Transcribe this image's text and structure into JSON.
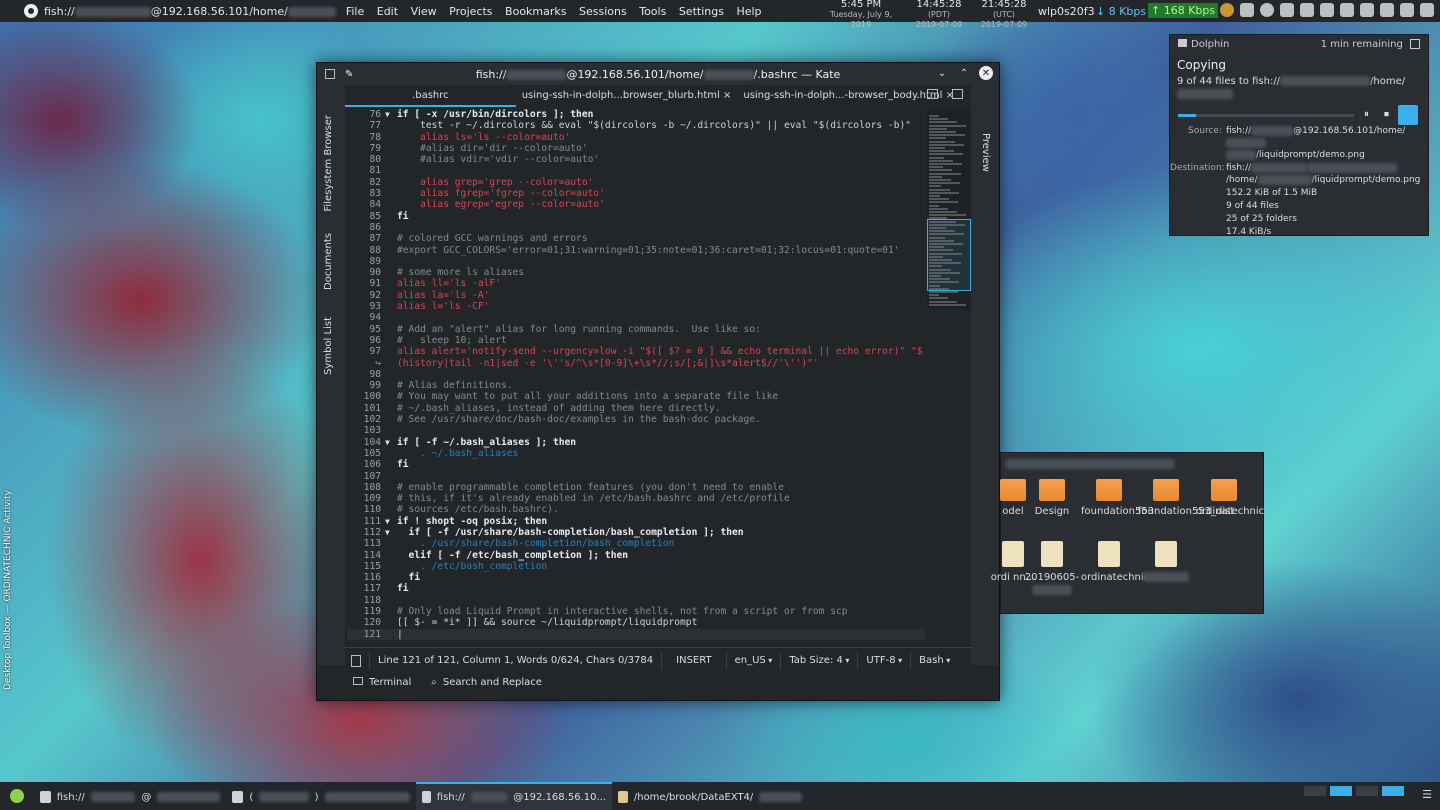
{
  "topbar": {
    "app": "fish://",
    "app_suffix": "@192.168.56.101/home/",
    "menu": [
      "File",
      "Edit",
      "View",
      "Projects",
      "Bookmarks",
      "Sessions",
      "Tools",
      "Settings",
      "Help"
    ],
    "clock1_time": "5:45 PM",
    "clock1_date": "Tuesday, July 9, 2019",
    "clock2_time": "14:45:28",
    "clock2_tz": "(PDT)",
    "clock2_date": "2019-07-09",
    "clock3_time": "21:45:28",
    "clock3_tz": "(UTC)",
    "clock3_date": "2019-07-09",
    "iface": "wlp0s20f3",
    "down": "8 Kbps",
    "up": "168 Kbps"
  },
  "kate": {
    "title_prefix": "fish://",
    "title_mid": "@192.168.56.101/home/",
    "title_suffix": "/.bashrc — Kate",
    "tabs": [
      ".bashrc",
      "using-ssh-in-dolph...browser_blurb.html",
      "using-ssh-in-dolph...-browser_body.html"
    ],
    "left_panels": [
      "Filesystem Browser",
      "Documents",
      "Symbol List"
    ],
    "right_panels": [
      "Preview"
    ],
    "lines": [
      {
        "n": "76",
        "f": "▼",
        "t": "if [ -x /usr/bin/dircolors ]; then"
      },
      {
        "n": "77",
        "f": "",
        "t": "    test -r ~/.dircolors && eval \"$(dircolors -b ~/.dircolors)\" || eval \"$(dircolors -b)\""
      },
      {
        "n": "78",
        "f": "",
        "t": "    alias ls='ls --color=auto'"
      },
      {
        "n": "79",
        "f": "",
        "t": "    #alias dir='dir --color=auto'"
      },
      {
        "n": "80",
        "f": "",
        "t": "    #alias vdir='vdir --color=auto'"
      },
      {
        "n": "81",
        "f": "",
        "t": ""
      },
      {
        "n": "82",
        "f": "",
        "t": "    alias grep='grep --color=auto'"
      },
      {
        "n": "83",
        "f": "",
        "t": "    alias fgrep='fgrep --color=auto'"
      },
      {
        "n": "84",
        "f": "",
        "t": "    alias egrep='egrep --color=auto'"
      },
      {
        "n": "85",
        "f": "",
        "t": "fi"
      },
      {
        "n": "86",
        "f": "",
        "t": ""
      },
      {
        "n": "87",
        "f": "",
        "t": "# colored GCC warnings and errors"
      },
      {
        "n": "88",
        "f": "",
        "t": "#export GCC_COLORS='error=01;31:warning=01;35:note=01;36:caret=01;32:locus=01:quote=01'"
      },
      {
        "n": "89",
        "f": "",
        "t": ""
      },
      {
        "n": "90",
        "f": "",
        "t": "# some more ls aliases"
      },
      {
        "n": "91",
        "f": "",
        "t": "alias ll='ls -alF'"
      },
      {
        "n": "92",
        "f": "",
        "t": "alias la='ls -A'"
      },
      {
        "n": "93",
        "f": "",
        "t": "alias l='ls -CF'"
      },
      {
        "n": "94",
        "f": "",
        "t": ""
      },
      {
        "n": "95",
        "f": "",
        "t": "# Add an \"alert\" alias for long running commands.  Use like so:"
      },
      {
        "n": "96",
        "f": "",
        "t": "#   sleep 10; alert"
      },
      {
        "n": "97",
        "f": "",
        "t": "alias alert='notify-send --urgency=low -i \"$([ $? = 0 ] && echo terminal || echo error)\" \"$"
      },
      {
        "n": "↪",
        "f": "",
        "t": "(history|tail -n1|sed -e '\\''s/^\\s*[0-9]\\+\\s*//;s/[;&|]\\s*alert$//'\\'')\"'"
      },
      {
        "n": "98",
        "f": "",
        "t": ""
      },
      {
        "n": "99",
        "f": "",
        "t": "# Alias definitions."
      },
      {
        "n": "100",
        "f": "",
        "t": "# You may want to put all your additions into a separate file like"
      },
      {
        "n": "101",
        "f": "",
        "t": "# ~/.bash_aliases, instead of adding them here directly."
      },
      {
        "n": "102",
        "f": "",
        "t": "# See /usr/share/doc/bash-doc/examples in the bash-doc package."
      },
      {
        "n": "103",
        "f": "",
        "t": ""
      },
      {
        "n": "104",
        "f": "▼",
        "t": "if [ -f ~/.bash_aliases ]; then"
      },
      {
        "n": "105",
        "f": "",
        "t": "    . ~/.bash_aliases"
      },
      {
        "n": "106",
        "f": "",
        "t": "fi"
      },
      {
        "n": "107",
        "f": "",
        "t": ""
      },
      {
        "n": "108",
        "f": "",
        "t": "# enable programmable completion features (you don't need to enable"
      },
      {
        "n": "109",
        "f": "",
        "t": "# this, if it's already enabled in /etc/bash.bashrc and /etc/profile"
      },
      {
        "n": "110",
        "f": "",
        "t": "# sources /etc/bash.bashrc)."
      },
      {
        "n": "111",
        "f": "▼",
        "t": "if ! shopt -oq posix; then"
      },
      {
        "n": "112",
        "f": "▼",
        "t": "  if [ -f /usr/share/bash-completion/bash_completion ]; then"
      },
      {
        "n": "113",
        "f": "",
        "t": "    . /usr/share/bash-completion/bash_completion"
      },
      {
        "n": "114",
        "f": "",
        "t": "  elif [ -f /etc/bash_completion ]; then"
      },
      {
        "n": "115",
        "f": "",
        "t": "    . /etc/bash_completion"
      },
      {
        "n": "116",
        "f": "",
        "t": "  fi"
      },
      {
        "n": "117",
        "f": "",
        "t": "fi"
      },
      {
        "n": "118",
        "f": "",
        "t": ""
      },
      {
        "n": "119",
        "f": "",
        "t": "# Only load Liquid Prompt in interactive shells, not from a script or from scp"
      },
      {
        "n": "120",
        "f": "",
        "t": "[[ $- = *i* ]] && source ~/liquidprompt/liquidprompt"
      },
      {
        "n": "121",
        "f": "",
        "t": "|"
      }
    ],
    "status": {
      "position": "Line 121 of 121, Column 1, Words 0/624, Chars 0/3784",
      "mode": "INSERT",
      "lang": "en_US",
      "tab": "Tab Size: 4",
      "enc": "UTF-8",
      "syntax": "Bash"
    },
    "toolviews": [
      "Terminal",
      "Search and Replace"
    ]
  },
  "notification": {
    "app": "Dolphin",
    "remaining": "1 min remaining",
    "heading": "Copying",
    "summary_prefix": "9 of 44 files to fish://",
    "summary_suffix": "/home/",
    "progress_percent": 10,
    "source_label": "Source:",
    "source_value": "fish://",
    "source_value2": "@192.168.56.101/home/",
    "source_value3": "/liquidprompt/demo.png",
    "dest_label": "Destination:",
    "dest_value": "fish://",
    "dest_value2": "/home/",
    "dest_value3": "/liquidprompt/demo.png",
    "stats": [
      "152.2 KiB of 1.5 MiB",
      "9 of 44 files",
      "25 of 25 folders",
      "17.4 KiB/s"
    ]
  },
  "folderview": {
    "items": [
      "odel",
      "Design",
      "foundation553",
      "foundation553_dist",
      "ordinatechnic",
      "ordi nn...",
      "20190605-",
      "ordinatechnic.co...",
      ""
    ]
  },
  "taskbar": {
    "tasks": [
      "fish://",
      "(",
      "fish://",
      "/home/brook/DataEXT4/"
    ],
    "task3_suffix": "@192.168.56.10...",
    "desktop_label": "Desktop Toolbox — ORDINATECHNIC Activity"
  }
}
